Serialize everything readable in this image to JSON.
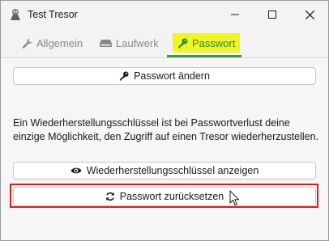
{
  "window": {
    "title": "Test Tresor"
  },
  "tabs": [
    {
      "label": "Allgemein",
      "icon": "wrench-icon"
    },
    {
      "label": "Laufwerk",
      "icon": "drive-icon"
    },
    {
      "label": "Passwort",
      "icon": "key-icon",
      "active": true
    }
  ],
  "colors": {
    "active_tab_text": "#2f8a2f",
    "active_tab_highlight": "#f0f528",
    "active_tab_underline": "#3c9a3c",
    "reset_highlight_border": "#d62020"
  },
  "password": {
    "change_label": "Passwort ändern",
    "info_text": "Ein Wiederherstellungsschlüssel ist bei Passwortverlust deine einzige Möglichkeit, den Zugriff auf einen Tresor wiederherzustellen.",
    "show_recovery_label": "Wiederherstellungsschlüssel anzeigen",
    "reset_label": "Passwort zurücksetzen"
  }
}
